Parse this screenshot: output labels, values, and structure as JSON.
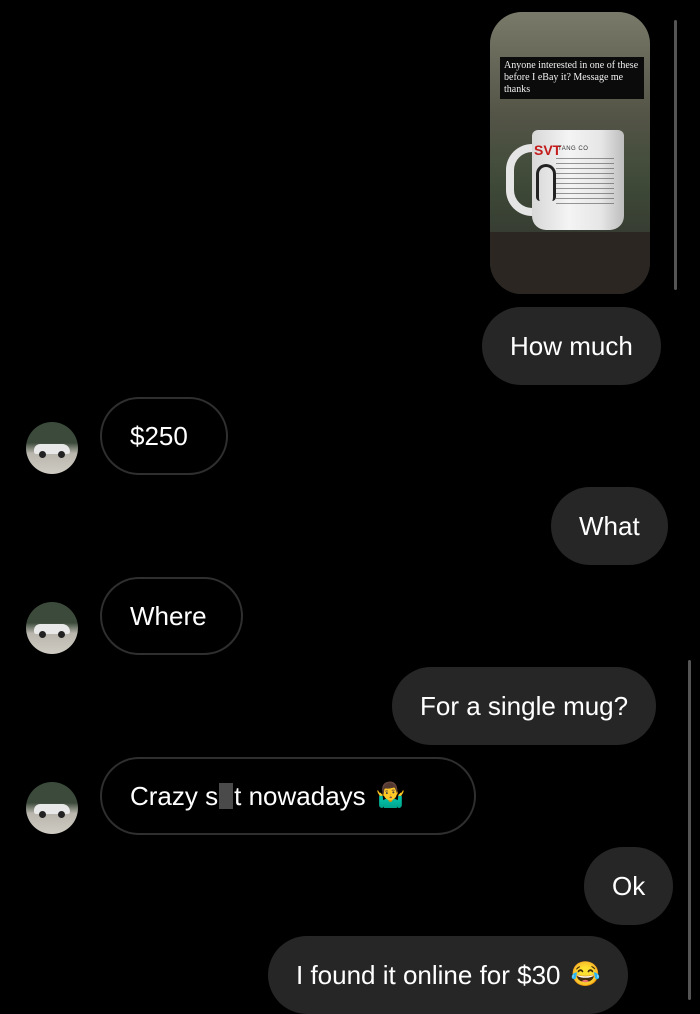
{
  "story": {
    "caption": "Anyone interested in one of these before I eBay it? Message me thanks",
    "mug_logo": "SVT",
    "mug_text": "TANG CO"
  },
  "messages": [
    {
      "from": "me",
      "text": "How much"
    },
    {
      "from": "them",
      "text": "$250"
    },
    {
      "from": "me",
      "text": "What"
    },
    {
      "from": "them",
      "text": "Where"
    },
    {
      "from": "me",
      "text": "For a single mug?"
    },
    {
      "from": "them",
      "text_before": "Crazy s",
      "text_after": "t nowadays",
      "emoji": "🤷‍♂️"
    },
    {
      "from": "me",
      "text": "Ok"
    },
    {
      "from": "me",
      "text": "I found it online for $30",
      "emoji": "😂"
    }
  ],
  "colors": {
    "background": "#000000",
    "outgoing_bubble": "#262626",
    "incoming_border": "#2f2f2f"
  }
}
